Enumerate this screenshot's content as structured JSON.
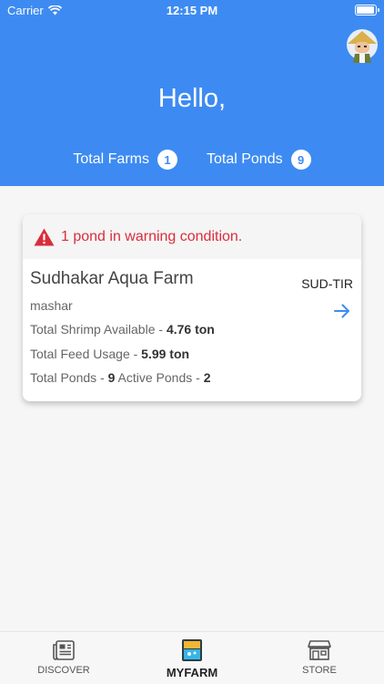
{
  "status": {
    "carrier": "Carrier",
    "time": "12:15 PM"
  },
  "header": {
    "greeting": "Hello,",
    "total_farms_label": "Total Farms",
    "total_farms_count": "1",
    "total_ponds_label": "Total Ponds",
    "total_ponds_count": "9"
  },
  "farm_card": {
    "warning": "1 pond in warning condition.",
    "name": "Sudhakar Aqua Farm",
    "code": "SUD-TIR",
    "owner": "mashar",
    "shrimp_label": "Total Shrimp Available - ",
    "shrimp_value": "4.76 ton",
    "feed_label": "Total Feed Usage - ",
    "feed_value": "5.99 ton",
    "ponds_label": "Total Ponds - ",
    "ponds_value": "9",
    "active_label": " Active Ponds - ",
    "active_value": "2"
  },
  "tabs": {
    "discover": "DISCOVER",
    "myfarm": "MYFARM",
    "store": "STORE"
  },
  "colors": {
    "primary": "#3d8bf2",
    "warning": "#d92d3c"
  }
}
